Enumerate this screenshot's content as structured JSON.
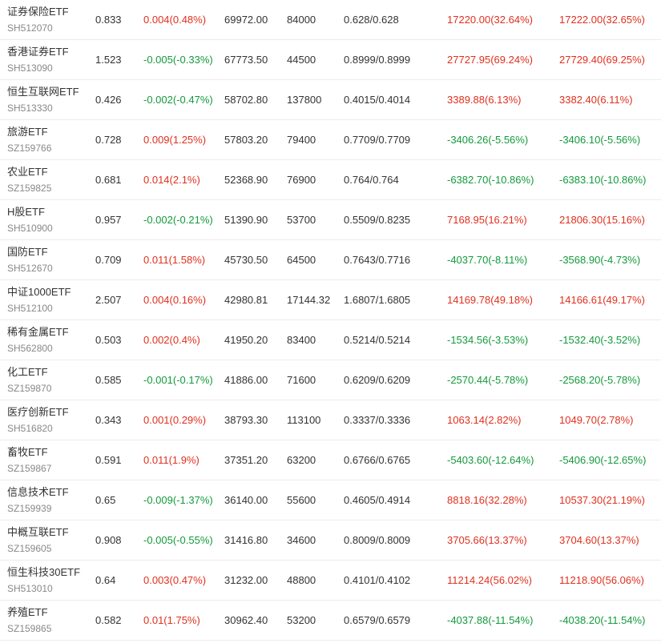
{
  "colors": {
    "up": "#e0301e",
    "down": "#139a3c",
    "text": "#333333",
    "code": "#888888"
  },
  "rows": [
    {
      "name": "证券保险ETF",
      "code": "SH512070",
      "price": "0.833",
      "change": "0.004(0.48%)",
      "change_dir": "up",
      "amount": "69972.00",
      "volume": "84000",
      "bidask": "0.628/0.628",
      "profit1": "17220.00(32.64%)",
      "profit1_dir": "up",
      "profit2": "17222.00(32.65%)",
      "profit2_dir": "up"
    },
    {
      "name": "香港证券ETF",
      "code": "SH513090",
      "price": "1.523",
      "change": "-0.005(-0.33%)",
      "change_dir": "down",
      "amount": "67773.50",
      "volume": "44500",
      "bidask": "0.8999/0.8999",
      "profit1": "27727.95(69.24%)",
      "profit1_dir": "up",
      "profit2": "27729.40(69.25%)",
      "profit2_dir": "up"
    },
    {
      "name": "恒生互联网ETF",
      "code": "SH513330",
      "price": "0.426",
      "change": "-0.002(-0.47%)",
      "change_dir": "down",
      "amount": "58702.80",
      "volume": "137800",
      "bidask": "0.4015/0.4014",
      "profit1": "3389.88(6.13%)",
      "profit1_dir": "up",
      "profit2": "3382.40(6.11%)",
      "profit2_dir": "up"
    },
    {
      "name": "旅游ETF",
      "code": "SZ159766",
      "price": "0.728",
      "change": "0.009(1.25%)",
      "change_dir": "up",
      "amount": "57803.20",
      "volume": "79400",
      "bidask": "0.7709/0.7709",
      "profit1": "-3406.26(-5.56%)",
      "profit1_dir": "down",
      "profit2": "-3406.10(-5.56%)",
      "profit2_dir": "down"
    },
    {
      "name": "农业ETF",
      "code": "SZ159825",
      "price": "0.681",
      "change": "0.014(2.1%)",
      "change_dir": "up",
      "amount": "52368.90",
      "volume": "76900",
      "bidask": "0.764/0.764",
      "profit1": "-6382.70(-10.86%)",
      "profit1_dir": "down",
      "profit2": "-6383.10(-10.86%)",
      "profit2_dir": "down"
    },
    {
      "name": "H股ETF",
      "code": "SH510900",
      "price": "0.957",
      "change": "-0.002(-0.21%)",
      "change_dir": "down",
      "amount": "51390.90",
      "volume": "53700",
      "bidask": "0.5509/0.8235",
      "profit1": "7168.95(16.21%)",
      "profit1_dir": "up",
      "profit2": "21806.30(15.16%)",
      "profit2_dir": "up"
    },
    {
      "name": "国防ETF",
      "code": "SH512670",
      "price": "0.709",
      "change": "0.011(1.58%)",
      "change_dir": "up",
      "amount": "45730.50",
      "volume": "64500",
      "bidask": "0.7643/0.7716",
      "profit1": "-4037.70(-8.11%)",
      "profit1_dir": "down",
      "profit2": "-3568.90(-4.73%)",
      "profit2_dir": "down"
    },
    {
      "name": "中证1000ETF",
      "code": "SH512100",
      "price": "2.507",
      "change": "0.004(0.16%)",
      "change_dir": "up",
      "amount": "42980.81",
      "volume": "17144.32",
      "bidask": "1.6807/1.6805",
      "profit1": "14169.78(49.18%)",
      "profit1_dir": "up",
      "profit2": "14166.61(49.17%)",
      "profit2_dir": "up"
    },
    {
      "name": "稀有金属ETF",
      "code": "SH562800",
      "price": "0.503",
      "change": "0.002(0.4%)",
      "change_dir": "up",
      "amount": "41950.20",
      "volume": "83400",
      "bidask": "0.5214/0.5214",
      "profit1": "-1534.56(-3.53%)",
      "profit1_dir": "down",
      "profit2": "-1532.40(-3.52%)",
      "profit2_dir": "down"
    },
    {
      "name": "化工ETF",
      "code": "SZ159870",
      "price": "0.585",
      "change": "-0.001(-0.17%)",
      "change_dir": "down",
      "amount": "41886.00",
      "volume": "71600",
      "bidask": "0.6209/0.6209",
      "profit1": "-2570.44(-5.78%)",
      "profit1_dir": "down",
      "profit2": "-2568.20(-5.78%)",
      "profit2_dir": "down"
    },
    {
      "name": "医疗创新ETF",
      "code": "SH516820",
      "price": "0.343",
      "change": "0.001(0.29%)",
      "change_dir": "up",
      "amount": "38793.30",
      "volume": "113100",
      "bidask": "0.3337/0.3336",
      "profit1": "1063.14(2.82%)",
      "profit1_dir": "up",
      "profit2": "1049.70(2.78%)",
      "profit2_dir": "up"
    },
    {
      "name": "畜牧ETF",
      "code": "SZ159867",
      "price": "0.591",
      "change": "0.011(1.9%)",
      "change_dir": "up",
      "amount": "37351.20",
      "volume": "63200",
      "bidask": "0.6766/0.6765",
      "profit1": "-5403.60(-12.64%)",
      "profit1_dir": "down",
      "profit2": "-5406.90(-12.65%)",
      "profit2_dir": "down"
    },
    {
      "name": "信息技术ETF",
      "code": "SZ159939",
      "price": "0.65",
      "change": "-0.009(-1.37%)",
      "change_dir": "down",
      "amount": "36140.00",
      "volume": "55600",
      "bidask": "0.4605/0.4914",
      "profit1": "8818.16(32.28%)",
      "profit1_dir": "up",
      "profit2": "10537.30(21.19%)",
      "profit2_dir": "up"
    },
    {
      "name": "中概互联ETF",
      "code": "SZ159605",
      "price": "0.908",
      "change": "-0.005(-0.55%)",
      "change_dir": "down",
      "amount": "31416.80",
      "volume": "34600",
      "bidask": "0.8009/0.8009",
      "profit1": "3705.66(13.37%)",
      "profit1_dir": "up",
      "profit2": "3704.60(13.37%)",
      "profit2_dir": "up"
    },
    {
      "name": "恒生科技30ETF",
      "code": "SH513010",
      "price": "0.64",
      "change": "0.003(0.47%)",
      "change_dir": "up",
      "amount": "31232.00",
      "volume": "48800",
      "bidask": "0.4101/0.4102",
      "profit1": "11214.24(56.02%)",
      "profit1_dir": "up",
      "profit2": "11218.90(56.06%)",
      "profit2_dir": "up"
    },
    {
      "name": "养殖ETF",
      "code": "SZ159865",
      "price": "0.582",
      "change": "0.01(1.75%)",
      "change_dir": "up",
      "amount": "30962.40",
      "volume": "53200",
      "bidask": "0.6579/0.6579",
      "profit1": "-4037.88(-11.54%)",
      "profit1_dir": "down",
      "profit2": "-4038.20(-11.54%)",
      "profit2_dir": "down"
    }
  ]
}
